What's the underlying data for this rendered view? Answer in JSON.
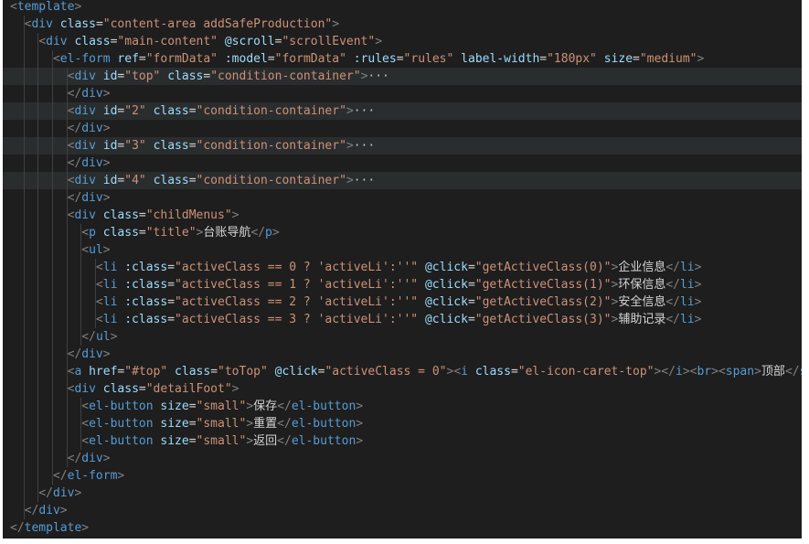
{
  "editor": {
    "language": "vue-template",
    "lines": [
      "<template>",
      "  <div class=\"content-area addSafeProduction\">",
      "    <div class=\"main-content\" @scroll=\"scrollEvent\">",
      "      <el-form ref=\"formData\" :model=\"formData\" :rules=\"rules\" label-width=\"180px\" size=\"medium\">",
      "        <div id=\"top\" class=\"condition-container\">···",
      "        </div>",
      "        <div id=\"2\" class=\"condition-container\">···",
      "        </div>",
      "        <div id=\"3\" class=\"condition-container\">···",
      "        </div>",
      "        <div id=\"4\" class=\"condition-container\">···",
      "        </div>",
      "        <div class=\"childMenus\">",
      "          <p class=\"title\">台账导航</p>",
      "          <ul>",
      "            <li :class=\"activeClass == 0 ? 'activeLi':''\" @click=\"getActiveClass(0)\">企业信息</li>",
      "            <li :class=\"activeClass == 1 ? 'activeLi':''\" @click=\"getActiveClass(1)\">环保信息</li>",
      "            <li :class=\"activeClass == 2 ? 'activeLi':''\" @click=\"getActiveClass(2)\">安全信息</li>",
      "            <li :class=\"activeClass == 3 ? 'activeLi':''\" @click=\"getActiveClass(3)\">辅助记录</li>",
      "          </ul>",
      "        </div>",
      "        <a href=\"#top\" class=\"toTop\" @click=\"activeClass = 0\"><i class=\"el-icon-caret-top\"></i><br><span>顶部</s",
      "        <div class=\"detailFoot\">",
      "          <el-button size=\"small\">保存</el-button>",
      "          <el-button size=\"small\">重置</el-button>",
      "          <el-button size=\"small\">返回</el-button>",
      "        </div>",
      "      </el-form>",
      "    </div>",
      "  </div>",
      "</template>"
    ],
    "highlighted_lines": [
      4,
      6,
      8,
      10
    ],
    "folded_lines": [
      4,
      6,
      8,
      10
    ],
    "colors": {
      "background": "#1e1e1e",
      "highlight": "#2a2d2e",
      "punctuation": "#808080",
      "tag": "#569cd6",
      "attribute": "#9cdcfe",
      "value": "#ce9178",
      "text": "#d4d4d4"
    }
  }
}
